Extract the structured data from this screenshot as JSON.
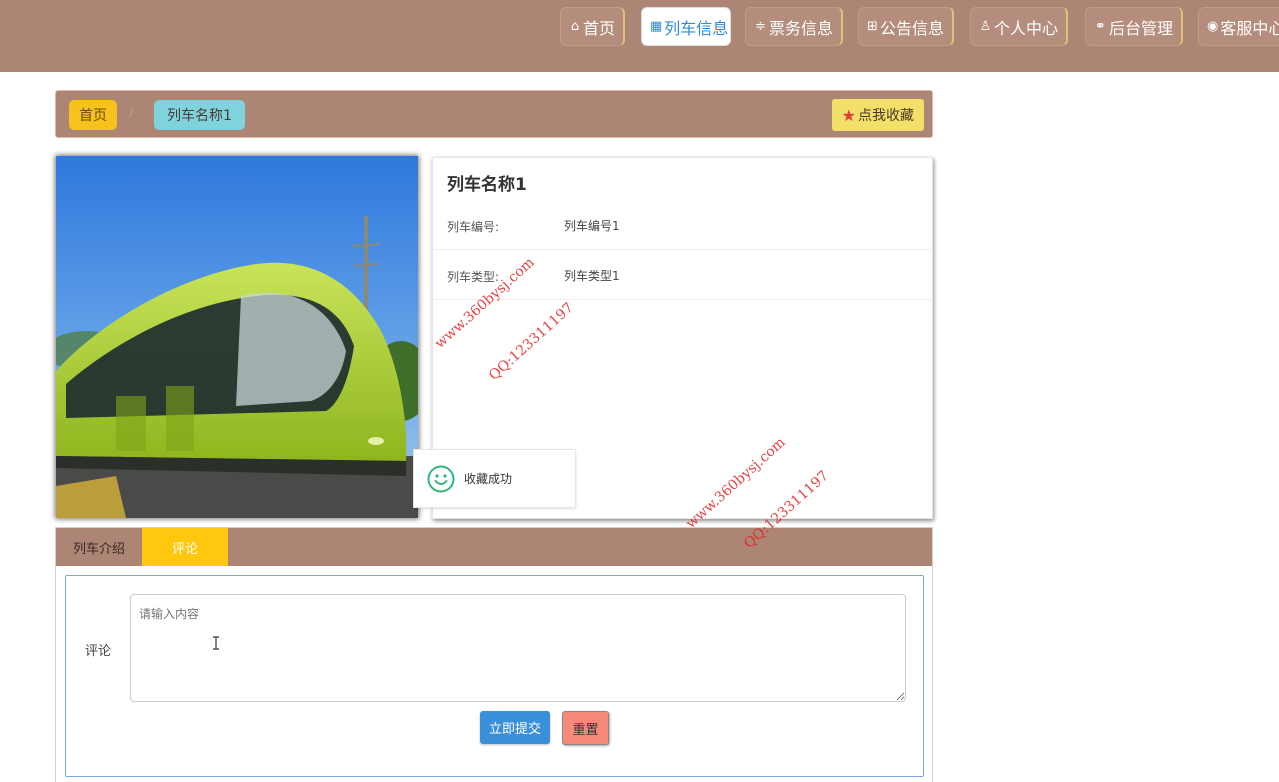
{
  "nav": {
    "items": [
      {
        "icon": "home-icon",
        "glyph": "⌂",
        "label": "首页"
      },
      {
        "icon": "grid-icon",
        "glyph": "▦",
        "label": "列车信息",
        "active": true
      },
      {
        "icon": "sliders-icon",
        "glyph": "≑",
        "label": "票务信息"
      },
      {
        "icon": "gift-icon",
        "glyph": "⊞",
        "label": "公告信息"
      },
      {
        "icon": "user-icon",
        "glyph": "♙",
        "label": "个人中心"
      },
      {
        "icon": "link-icon",
        "glyph": "⚭",
        "label": "后台管理"
      },
      {
        "icon": "support-icon",
        "glyph": "◉",
        "label": "客服中心"
      }
    ]
  },
  "breadcrumb": {
    "home": "首页",
    "separator": "/",
    "current": "列车名称1",
    "favorite_label": "点我收藏"
  },
  "detail": {
    "title": "列车名称1",
    "rows": [
      {
        "label": "列车编号:",
        "value": "列车编号1"
      },
      {
        "label": "列车类型:",
        "value": "列车类型1"
      }
    ]
  },
  "toast": {
    "message": "收藏成功"
  },
  "tabs": {
    "intro": "列车介绍",
    "comment": "评论"
  },
  "comment_form": {
    "label": "评论",
    "placeholder": "请输入内容",
    "submit": "立即提交",
    "reset": "重置"
  },
  "watermarks": {
    "site": "www.360bysj.com",
    "qq": "QQ:123311197"
  },
  "colors": {
    "header_bg": "#ad8574",
    "active_tab": "#ffc80f",
    "submit": "#3a8fd9",
    "reset": "#f7897b"
  }
}
